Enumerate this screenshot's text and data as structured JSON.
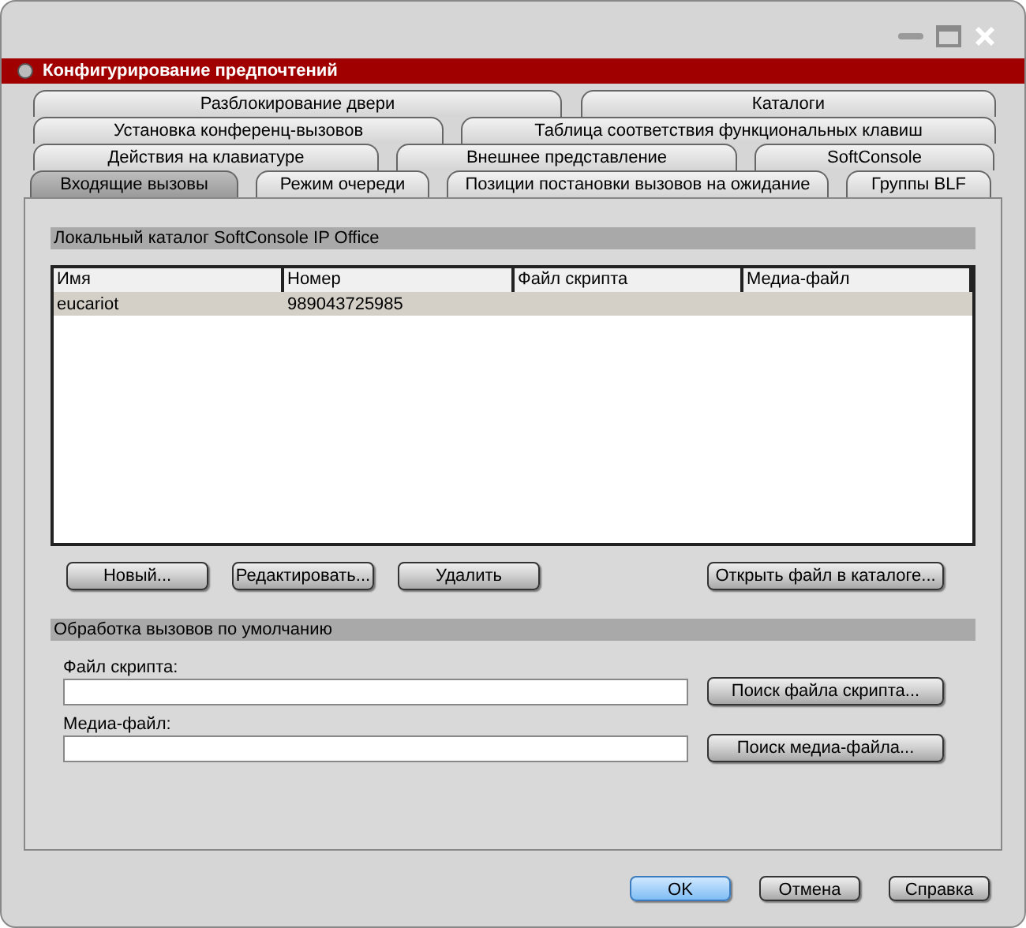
{
  "window": {
    "title": "Конфигурирование предпочтений"
  },
  "tab_rows": [
    [
      {
        "label": "Разблокирование двери",
        "selected": false
      },
      {
        "label": "Каталоги",
        "selected": false
      }
    ],
    [
      {
        "label": "Установка конференц-вызовов",
        "selected": false
      },
      {
        "label": "Таблица соответствия функциональных клавиш",
        "selected": false
      }
    ],
    [
      {
        "label": "Действия на клавиатуре",
        "selected": false
      },
      {
        "label": "Внешнее представление",
        "selected": false
      },
      {
        "label": "SoftConsole",
        "selected": false
      }
    ],
    [
      {
        "label": "Входящие вызовы",
        "selected": true
      },
      {
        "label": "Режим очереди",
        "selected": false
      },
      {
        "label": "Позиции постановки вызовов на ожидание",
        "selected": false
      },
      {
        "label": "Группы BLF",
        "selected": false
      }
    ]
  ],
  "catalog": {
    "title": "Локальный каталог SoftConsole IP Office",
    "columns": [
      "Имя",
      "Номер",
      "Файл скрипта",
      "Медиа-файл"
    ],
    "rows": [
      {
        "cells": [
          "eucariot",
          "989043725985"
        ],
        "selected": true
      }
    ],
    "buttons": [
      "Новый...",
      "Редактировать...",
      "Удалить"
    ],
    "open_button": "Открыть файл в каталоге..."
  },
  "default_handling": {
    "title": "Обработка вызовов по умолчанию",
    "fields": [
      {
        "label": "Файл скрипта:",
        "button": "Поиск файла скрипта..."
      },
      {
        "label": "Медиа-файл:",
        "button": "Поиск медиа-файла..."
      }
    ]
  },
  "footer_buttons": [
    {
      "label": "OK",
      "kind": "primary"
    },
    {
      "label": "Отмена",
      "kind": "normal"
    },
    {
      "label": "Справка",
      "kind": "normal"
    }
  ]
}
